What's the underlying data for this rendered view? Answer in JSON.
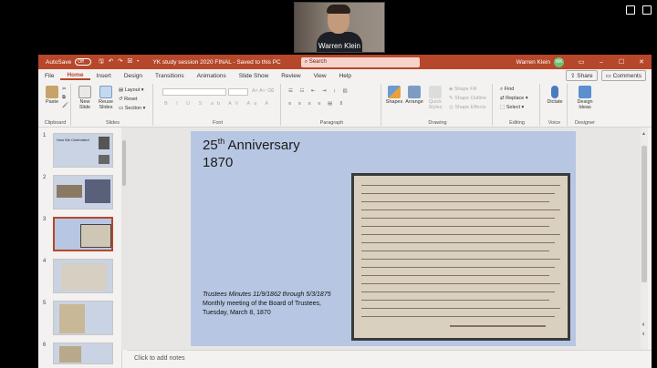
{
  "video": {
    "participant_name": "Warren Klein"
  },
  "titlebar": {
    "autosave_label": "AutoSave",
    "autosave_state": "Off",
    "document_title": "YK study session 2020 FINAL - Saved to this PC",
    "search_placeholder": "Search",
    "user_name": "Warren Klein",
    "user_initials": "WK"
  },
  "menu": {
    "items": [
      "File",
      "Home",
      "Insert",
      "Design",
      "Transitions",
      "Animations",
      "Slide Show",
      "Review",
      "View",
      "Help"
    ],
    "active": "Home",
    "share_label": "Share",
    "comments_label": "Comments"
  },
  "ribbon": {
    "clipboard": {
      "paste": "Paste",
      "label": "Clipboard"
    },
    "slides": {
      "new_slide": "New Slide",
      "reuse_slides": "Reuse Slides",
      "layout": "Layout",
      "reset": "Reset",
      "section": "Section",
      "label": "Slides"
    },
    "font": {
      "label": "Font"
    },
    "paragraph": {
      "label": "Paragraph"
    },
    "drawing": {
      "shapes": "Shapes",
      "arrange": "Arrange",
      "quick_styles": "Quick Styles",
      "shape_fill": "Shape Fill",
      "shape_outline": "Shape Outline",
      "shape_effects": "Shape Effects",
      "label": "Drawing"
    },
    "editing": {
      "find": "Find",
      "replace": "Replace",
      "select": "Select",
      "label": "Editing"
    },
    "voice": {
      "dictate": "Dictate",
      "label": "Voice"
    },
    "designer": {
      "design_ideas": "Design Ideas",
      "label": "Designer"
    }
  },
  "thumbnails": {
    "numbers": [
      "1",
      "2",
      "3",
      "4",
      "5",
      "6"
    ],
    "selected_index": 2,
    "slide1_title": "How We Celebrated"
  },
  "slide": {
    "title_prefix": "25",
    "title_sup": "th",
    "title_suffix": " Anniversary",
    "year": "1870",
    "caption_line1": "Trustees Minutes 11/9/1862 through 5/3/1875",
    "caption_line2": "Monthly meeting of the Board of Trustees,",
    "caption_line3": "Tuesday, March 8, 1870"
  },
  "notes": {
    "placeholder": "Click to add notes"
  }
}
